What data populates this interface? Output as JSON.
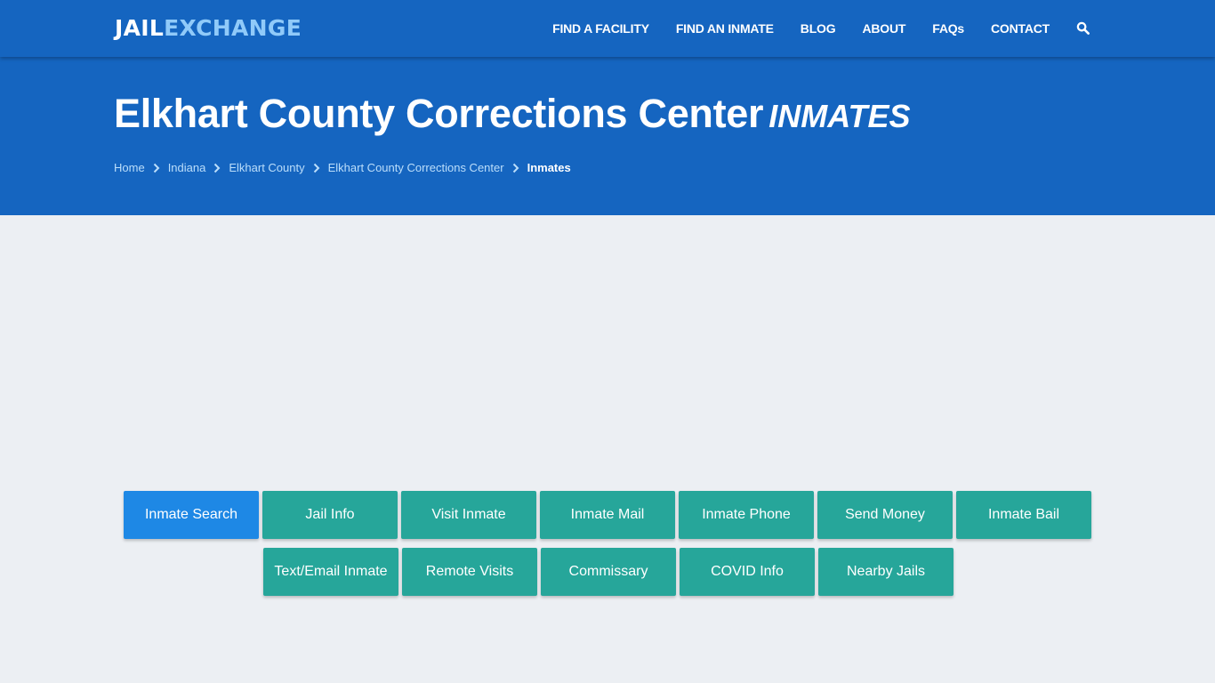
{
  "header": {
    "logo_part1": "JAIL",
    "logo_part2": "EXCHANGE",
    "nav": [
      {
        "label": "FIND A FACILITY"
      },
      {
        "label": "FIND AN INMATE"
      },
      {
        "label": "BLOG"
      },
      {
        "label": "ABOUT"
      },
      {
        "label": "FAQs"
      },
      {
        "label": "CONTACT"
      }
    ],
    "search_icon": "search-icon"
  },
  "hero": {
    "title": "Elkhart County Corrections Center",
    "title_suffix": "INMATES",
    "breadcrumb": [
      {
        "label": "Home"
      },
      {
        "label": "Indiana"
      },
      {
        "label": "Elkhart County"
      },
      {
        "label": "Elkhart County Corrections Center"
      }
    ],
    "breadcrumb_current": "Inmates"
  },
  "buttons": {
    "row1": [
      {
        "label": "Inmate Search",
        "active": true
      },
      {
        "label": "Jail Info"
      },
      {
        "label": "Visit Inmate"
      },
      {
        "label": "Inmate Mail"
      },
      {
        "label": "Inmate Phone"
      },
      {
        "label": "Send Money"
      },
      {
        "label": "Inmate Bail"
      }
    ],
    "row2": [
      {
        "label": "Text/Email Inmate"
      },
      {
        "label": "Remote Visits"
      },
      {
        "label": "Commissary"
      },
      {
        "label": "COVID Info"
      },
      {
        "label": "Nearby Jails"
      }
    ]
  },
  "colors": {
    "brand": "#1565c0",
    "logo_accent": "#90caf9",
    "button": "#26a69a",
    "button_active": "#1e88e5",
    "page_bg": "#eceff3"
  }
}
